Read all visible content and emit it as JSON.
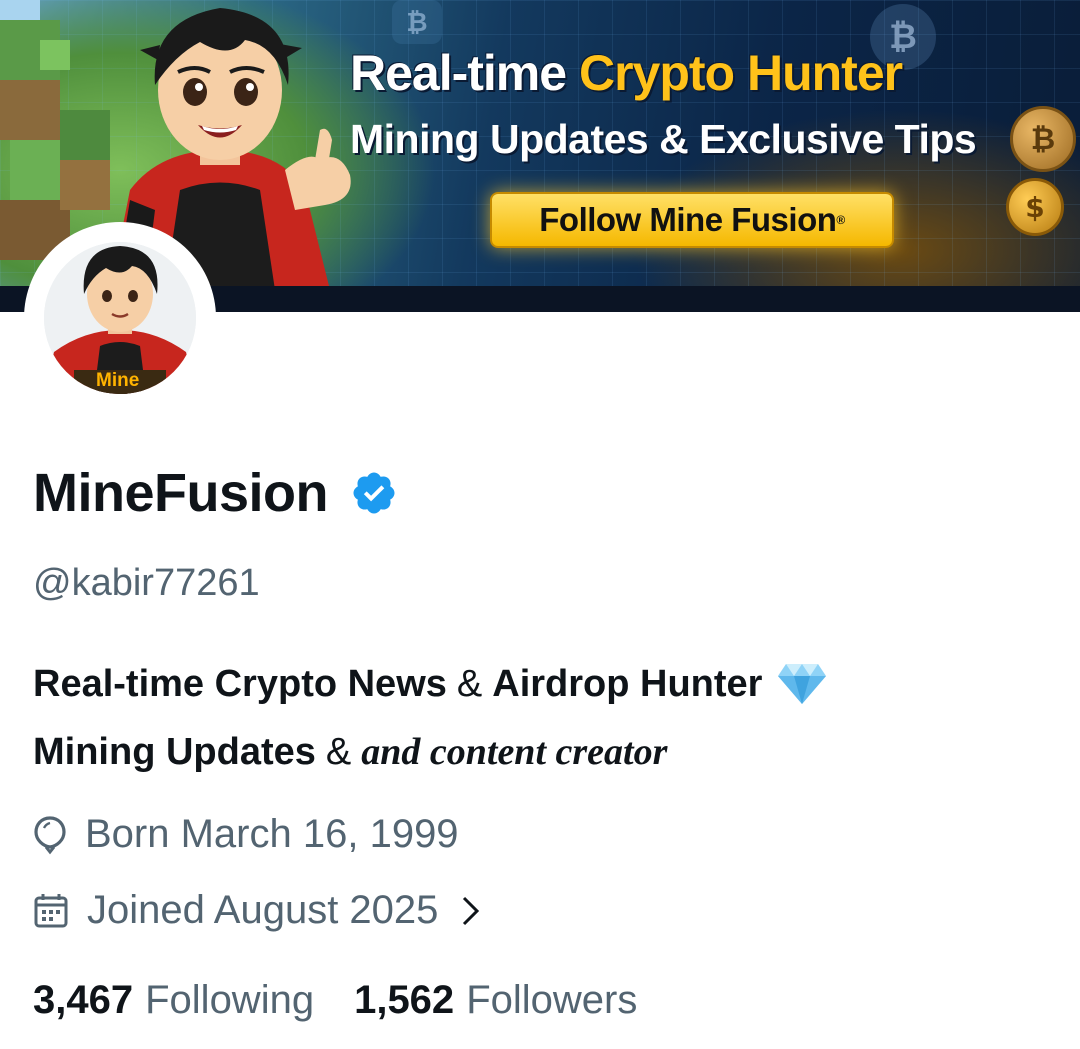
{
  "banner": {
    "title_part1": "Real-time",
    "title_part2": "Crypto Hunter",
    "subtitle": "Mining Updates & Exclusive Tips",
    "cta_label": "Follow Mine Fusion",
    "cta_trademark": "®",
    "accent_yellow": "#ffc21a",
    "background_navy": "#0b2547"
  },
  "avatar": {
    "alt": "MineFusion avatar",
    "overlay_text": "Mine"
  },
  "profile": {
    "display_name": "MineFusion",
    "verified": true,
    "verified_color": "#1d9bf0",
    "handle": "@kabir77261",
    "bio": {
      "line1_part1": "Real-time Crypto News",
      "line1_amp": "&",
      "line1_part2": "Airdrop Hunter",
      "line1_emoji": "gem-icon",
      "line2_part1": "Mining Updates",
      "line2_amp": "&",
      "line2_part2": "and content creator"
    },
    "birthday": "Born March 16, 1999",
    "joined": "Joined August 2025",
    "following_count": "3,467",
    "following_label": "Following",
    "followers_count": "1,562",
    "followers_label": "Followers"
  },
  "colors": {
    "primary_text": "#0f1419",
    "secondary_text": "#536471",
    "background": "#ffffff"
  }
}
